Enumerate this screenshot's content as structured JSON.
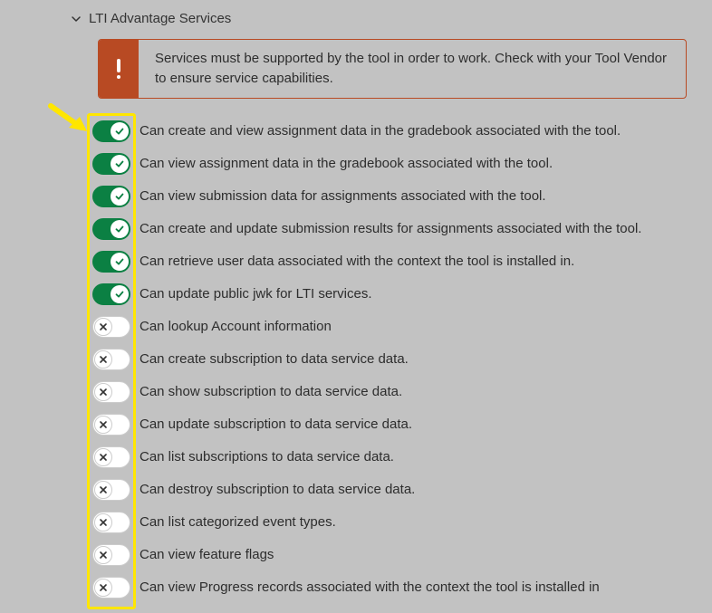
{
  "section_title": "LTI Advantage Services",
  "alert_text": "Services must be supported by the tool in order to work. Check with your Tool Vendor to ensure service capabilities.",
  "services": [
    {
      "enabled": true,
      "label": "Can create and view assignment data in the gradebook associated with the tool."
    },
    {
      "enabled": true,
      "label": "Can view assignment data in the gradebook associated with the tool."
    },
    {
      "enabled": true,
      "label": "Can view submission data for assignments associated with the tool."
    },
    {
      "enabled": true,
      "label": "Can create and update submission results for assignments associated with the tool."
    },
    {
      "enabled": true,
      "label": "Can retrieve user data associated with the context the tool is installed in."
    },
    {
      "enabled": true,
      "label": "Can update public jwk for LTI services."
    },
    {
      "enabled": false,
      "label": "Can lookup Account information"
    },
    {
      "enabled": false,
      "label": "Can create subscription to data service data."
    },
    {
      "enabled": false,
      "label": "Can show subscription to data service data."
    },
    {
      "enabled": false,
      "label": "Can update subscription to data service data."
    },
    {
      "enabled": false,
      "label": "Can list subscriptions to data service data."
    },
    {
      "enabled": false,
      "label": "Can destroy subscription to data service data."
    },
    {
      "enabled": false,
      "label": "Can list categorized event types."
    },
    {
      "enabled": false,
      "label": "Can view feature flags"
    },
    {
      "enabled": false,
      "label": "Can view Progress records associated with the context the tool is installed in"
    }
  ]
}
